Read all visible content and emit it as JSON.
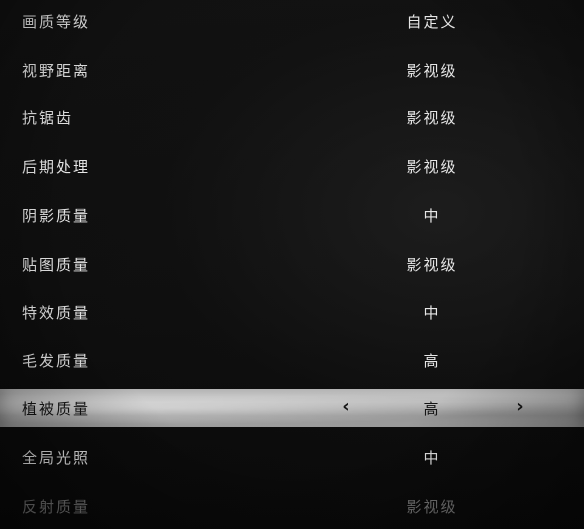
{
  "settings": [
    {
      "label": "画质等级",
      "value": "自定义"
    },
    {
      "label": "视野距离",
      "value": "影视级"
    },
    {
      "label": "抗锯齿",
      "value": "影视级"
    },
    {
      "label": "后期处理",
      "value": "影视级"
    },
    {
      "label": "阴影质量",
      "value": "中"
    },
    {
      "label": "贴图质量",
      "value": "影视级"
    },
    {
      "label": "特效质量",
      "value": "中"
    },
    {
      "label": "毛发质量",
      "value": "高"
    },
    {
      "label": "植被质量",
      "value": "高",
      "selected": true
    },
    {
      "label": "全局光照",
      "value": "中"
    },
    {
      "label": "反射质量",
      "value": "影视级"
    }
  ],
  "selector": {
    "prev_icon": "chevron-left-icon",
    "next_icon": "chevron-right-icon",
    "prev_glyph": "‹",
    "next_glyph": "›"
  },
  "colors": {
    "background": "#0e0e0e",
    "text": "#e6e6e6",
    "selected_bar": "#c9c9c9",
    "selected_text": "#151515"
  }
}
